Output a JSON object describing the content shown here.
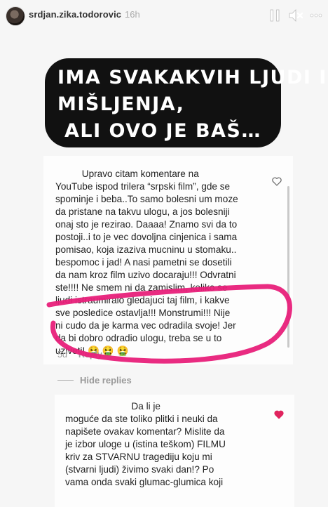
{
  "header": {
    "username": "srdjan.zika.todorovic",
    "time": "16h"
  },
  "title": {
    "line1": "IMA SVAKAKVIH LJUDI I",
    "line2": "MIŠLJENJA,",
    "line3": "ALI OVO JE BAŠ…"
  },
  "comment": {
    "text": "          Upravo citam komentare na\nYouTube ispod trilera “srpski film”, gde se\nspominje i beba..To samo bolesni um moze\nda pristane na takvu ulogu, a jos bolesniji\nonaj sto je rezirao. Daaaa! Znamo svi da to\npostoji..i to je vec dovoljna cinjenica i sama\npomisao, koja izaziva mucninu u stomaku..\nbespomoc i jad! A nasi pametni se dosetili\nda nam kroz film uzivo docaraju!!! Odvratni\nste!!!! Ne smem ni da zamislim, koliko se\nljudi istraumiralo gledajuci taj film, i kakve\nsve posledice ostavlja!!! Monstrumi!!! Nije\nni cudo da je karma vec odradila svoje! Jer\nda bi dobro odradio ulogu, treba se u to\nuziveti! 🤮 🤮 🤮",
    "age": "5d",
    "reply_label": "Reply"
  },
  "hide_replies_label": "Hide replies",
  "reply": {
    "text": "                         Da li je\nmoguće da ste toliko plitki i neuki da\nnapišete ovakav komentar? Mislite da\nje izbor uloge u (istina teškom) FILMU\nkriv za STVARNU tragediju koju mi\n(stvarni ljudi) živimo svaki dan!? Po\nvama onda svaki glumac-glumica koji"
  },
  "colors": {
    "title_bg": "#111111",
    "highlight": "#e8207a",
    "liked_heart": "#e0245e"
  },
  "icons": [
    "pause-icon",
    "mute-icon",
    "more-icon",
    "heart-outline-icon",
    "heart-filled-icon"
  ]
}
